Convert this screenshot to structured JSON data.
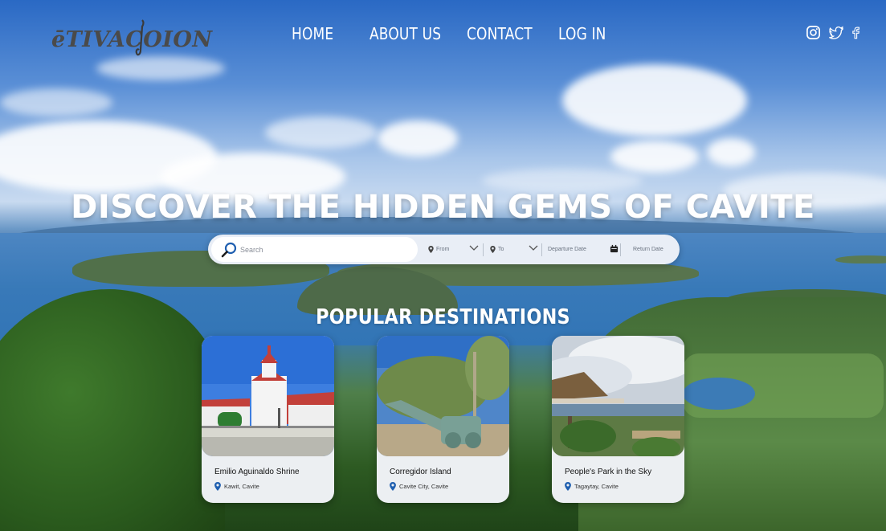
{
  "brand": {
    "logo_text": "ēTIVACOION"
  },
  "nav": {
    "items": [
      {
        "label": "HOME"
      },
      {
        "label": "ABOUT US"
      },
      {
        "label": "CONTACT"
      },
      {
        "label": "LOG IN"
      }
    ]
  },
  "social": {
    "icons": [
      "instagram-icon",
      "twitter-icon",
      "facebook-icon"
    ]
  },
  "hero": {
    "headline": "DISCOVER THE HIDDEN GEMS OF CAVITE"
  },
  "search": {
    "placeholder": "Search",
    "from_label": "From",
    "to_label": "To",
    "departure_label": "Departure Date",
    "return_label": "Return Date"
  },
  "popular": {
    "title": "POPULAR DESTINATIONS",
    "cards": [
      {
        "name": "Emilio Aguinaldo Shrine",
        "location": "Kawit, Cavite"
      },
      {
        "name": "Corregidor Island",
        "location": "Cavite City, Cavite"
      },
      {
        "name": "People's Park in the Sky",
        "location": "Tagaytay, Cavite"
      }
    ]
  },
  "colors": {
    "accent": "#1f5fb0",
    "text_light": "#ffffff",
    "card_bg": "#eceff2"
  }
}
